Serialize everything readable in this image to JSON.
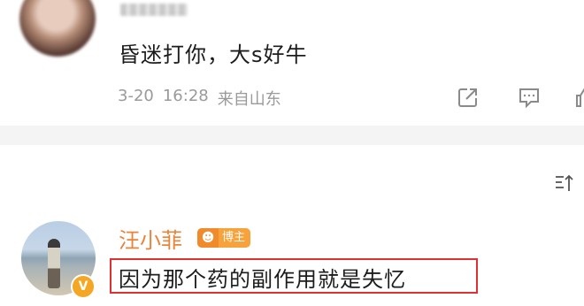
{
  "comment_1": {
    "text": "昏迷打你，大s好牛",
    "date": "3-20",
    "time": "16:28",
    "location": "来自山东"
  },
  "comment_2": {
    "username": "汪小菲",
    "badge": "博主",
    "text": "因为那个药的副作用就是失忆",
    "highlight_color": "#e0302f"
  },
  "icons": {
    "share": "share-icon",
    "reply": "comment-icon",
    "like": "like-icon",
    "sort": "sort-icon",
    "verified": "verified-v-icon"
  },
  "colors": {
    "username": "#e8853b",
    "meta": "#9a9a9a",
    "badge": "#f7a23a"
  }
}
